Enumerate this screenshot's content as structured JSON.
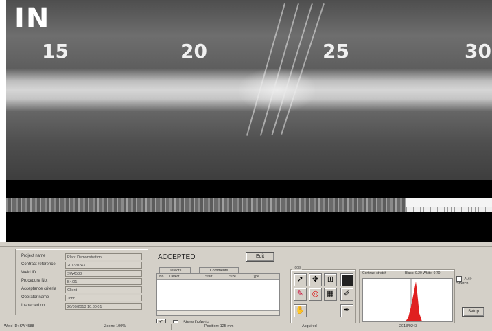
{
  "radiograph": {
    "marker": "IN",
    "scale": [
      "15",
      "20",
      "25",
      "30"
    ]
  },
  "info": [
    {
      "label": "Project name",
      "value": "Plant Demonstration"
    },
    {
      "label": "Contract reference",
      "value": "2013/0243"
    },
    {
      "label": "Weld ID",
      "value": "SW4588"
    },
    {
      "label": "Procedure No.",
      "value": "B4/01"
    },
    {
      "label": "Acceptance criteria",
      "value": "Client"
    },
    {
      "label": "Operator name",
      "value": "John"
    },
    {
      "label": "Inspected on",
      "value": "26/09/2013 10:30:01"
    }
  ],
  "status": {
    "label": "ACCEPTED",
    "button": "Edit"
  },
  "tabs": [
    "Defects",
    "Comments"
  ],
  "defects_table": {
    "columns": [
      "No.",
      "Defect",
      "Start",
      "Size",
      "Type"
    ]
  },
  "show_defects": "Show Defects",
  "tools": {
    "caption": "Tools"
  },
  "contrast": {
    "caption": "Contrast stretch",
    "minmax": "Black: 0.20  White: 0.70"
  },
  "auto": {
    "label": "Auto Stretch",
    "button": "Setup"
  },
  "statusbar": [
    "Weld ID: SW4588",
    "Zoom: 100%",
    "Position: 125 mm",
    "Acquired",
    "2013/0243"
  ]
}
